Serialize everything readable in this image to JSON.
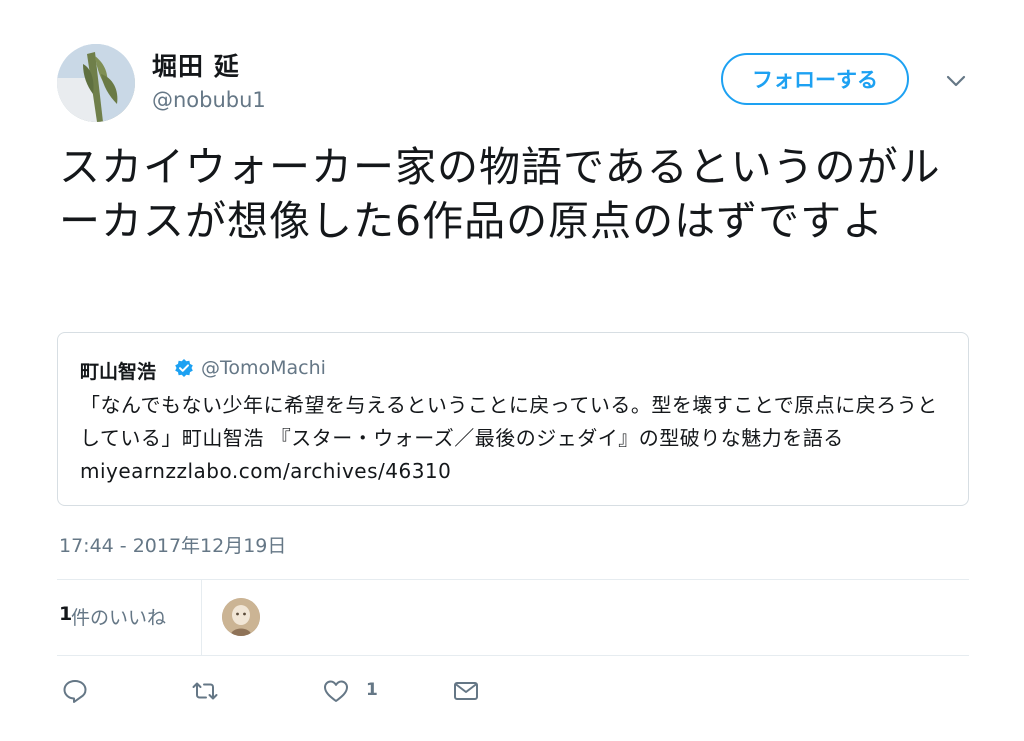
{
  "author": {
    "display_name": "堀田 延",
    "handle": "@nobubu1"
  },
  "follow_button_label": "フォローする",
  "tweet_text": "スカイウォーカー家の物語であるというのがルーカスが想像した6作品の原点のはずですよ",
  "quoted_tweet": {
    "display_name": "町山智浩",
    "handle": "@TomoMachi",
    "text": "「なんでもない少年に希望を与えるということに戻っている。型を壊すことで原点に戻ろうとしている」町山智浩 『スター・ウォーズ／最後のジェダイ』の型破りな魅力を語る miyearnzzlabo.com/archives/46310",
    "verified_icon": "verified-badge-icon"
  },
  "timestamp": "17:44 - 2017年12月19日",
  "likes": {
    "count": "1",
    "label": "件のいいね"
  },
  "actions": {
    "reply_icon": "reply-icon",
    "retweet_icon": "retweet-icon",
    "like_icon": "heart-icon",
    "like_count": "1",
    "dm_icon": "envelope-icon"
  },
  "colors": {
    "accent": "#1da1f2",
    "secondary_text": "#657786",
    "primary_text": "#14171a",
    "border": "#e6ecf0"
  }
}
